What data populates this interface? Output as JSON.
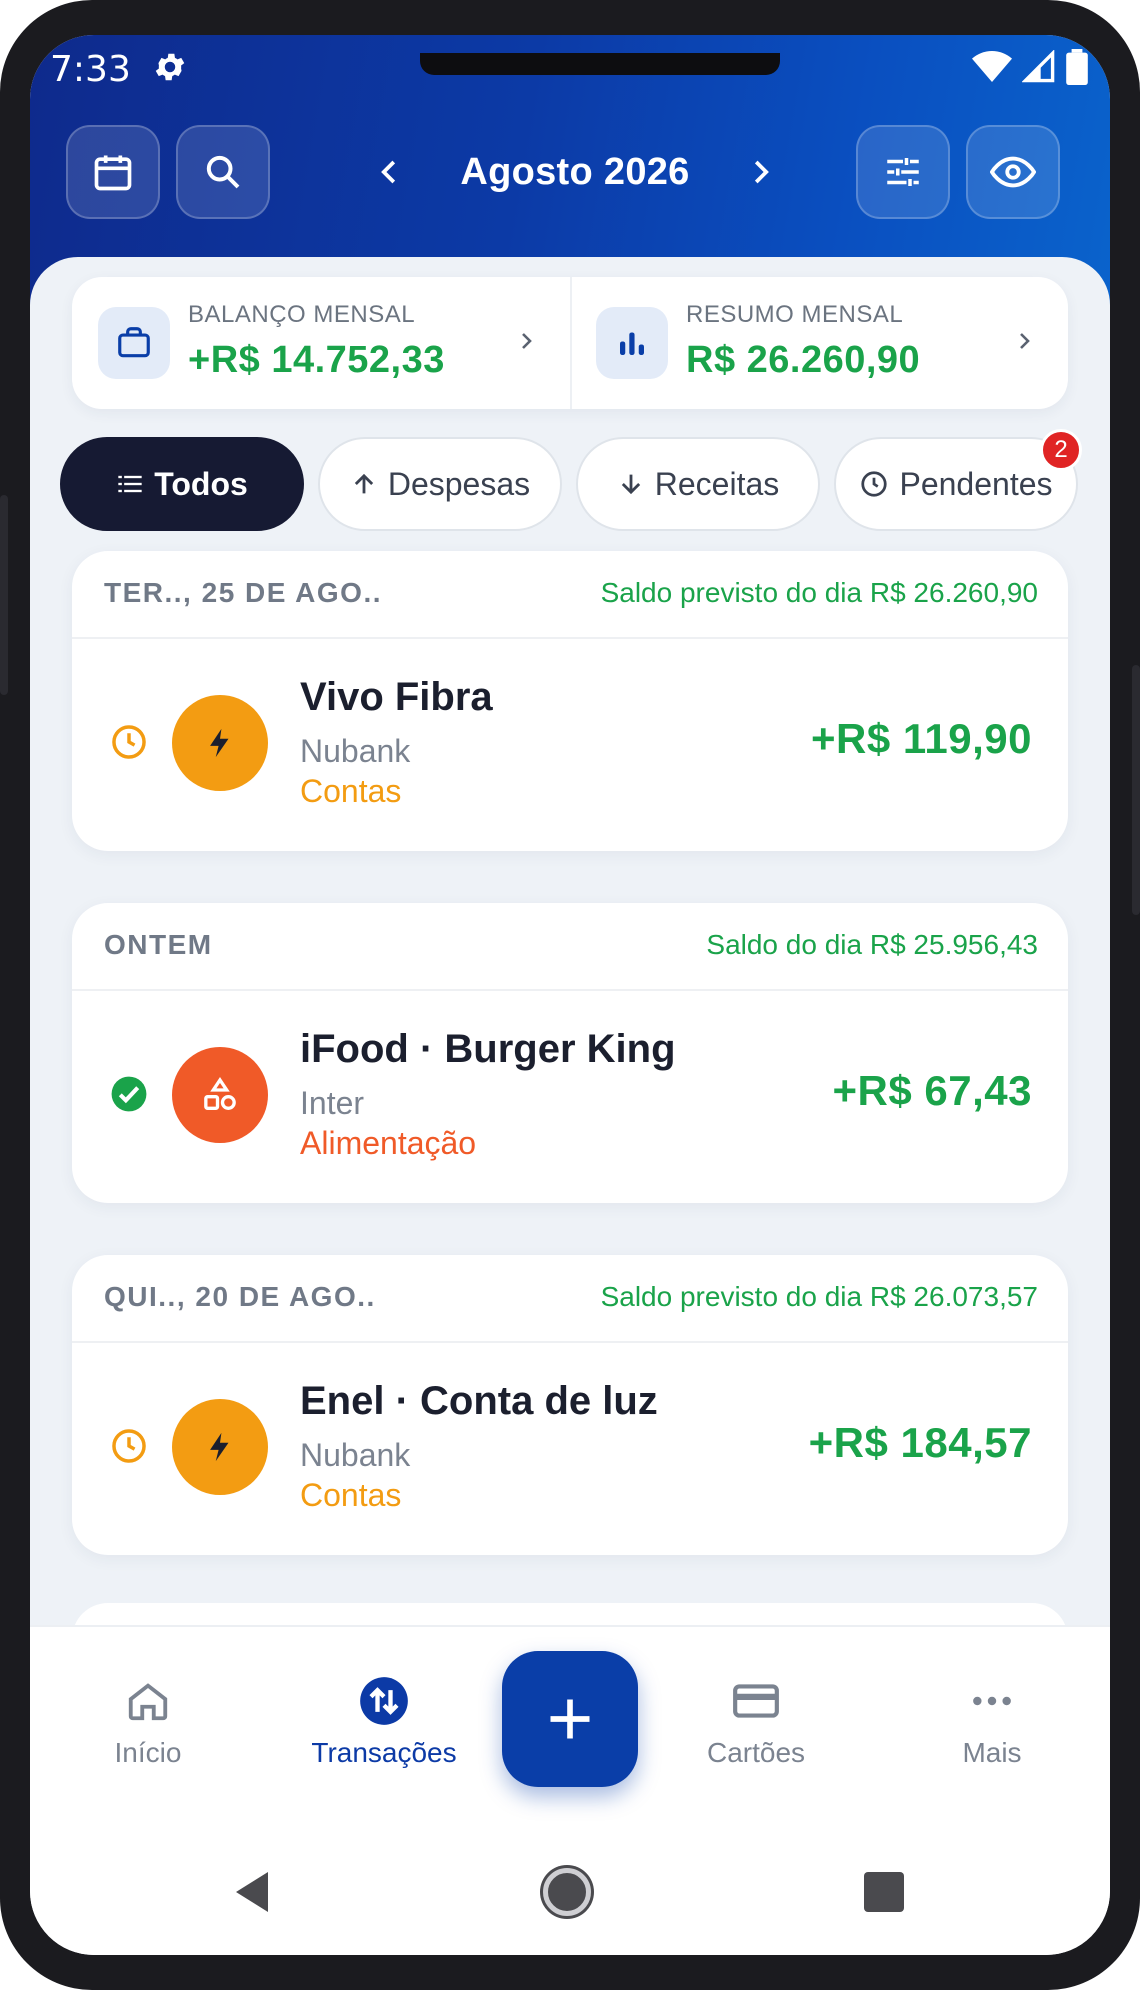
{
  "status_bar": {
    "time": "7:33"
  },
  "header": {
    "month_title": "Agosto 2026",
    "buttons": [
      "calendar-icon",
      "search-icon",
      "filter-sliders-icon",
      "eye-icon"
    ]
  },
  "summary": {
    "monthly_balance": {
      "label": "BALANÇO MENSAL",
      "value": "+R$ 14.752,33"
    },
    "monthly_summary": {
      "label": "RESUMO MENSAL",
      "value": "R$ 26.260,90"
    }
  },
  "filters": {
    "all": "Todos",
    "expenses": "Despesas",
    "income": "Receitas",
    "pending": "Pendentes",
    "pending_count": "2"
  },
  "groups": [
    {
      "date": "TER.., 25 DE AGO..",
      "balance": "Saldo previsto do dia R$ 26.260,90",
      "tx": {
        "title": "Vivo Fibra",
        "account": "Nubank",
        "category": "Contas",
        "amount": "+R$ 119,90",
        "status": "pending",
        "category_color": "#f39c12"
      }
    },
    {
      "date": "ONTEM",
      "balance": "Saldo do dia R$ 25.956,43",
      "tx": {
        "title": "iFood · Burger King",
        "account": "Inter",
        "category": "Alimentação",
        "amount": "+R$ 67,43",
        "status": "done",
        "category_color": "#f05a28"
      }
    },
    {
      "date": "QUI.., 20 DE AGO..",
      "balance": "Saldo previsto do dia R$ 26.073,57",
      "tx": {
        "title": "Enel · Conta de luz",
        "account": "Nubank",
        "category": "Contas",
        "amount": "+R$ 184,57",
        "status": "pending",
        "category_color": "#f39c12"
      }
    }
  ],
  "bottom_nav": {
    "home": "Início",
    "transactions": "Transações",
    "cards": "Cartões",
    "more": "Mais"
  },
  "colors": {
    "accent": "#0a3ea8",
    "positive": "#1aa34a",
    "bills": "#f39c12",
    "food": "#f05a28",
    "badge": "#e02424"
  }
}
